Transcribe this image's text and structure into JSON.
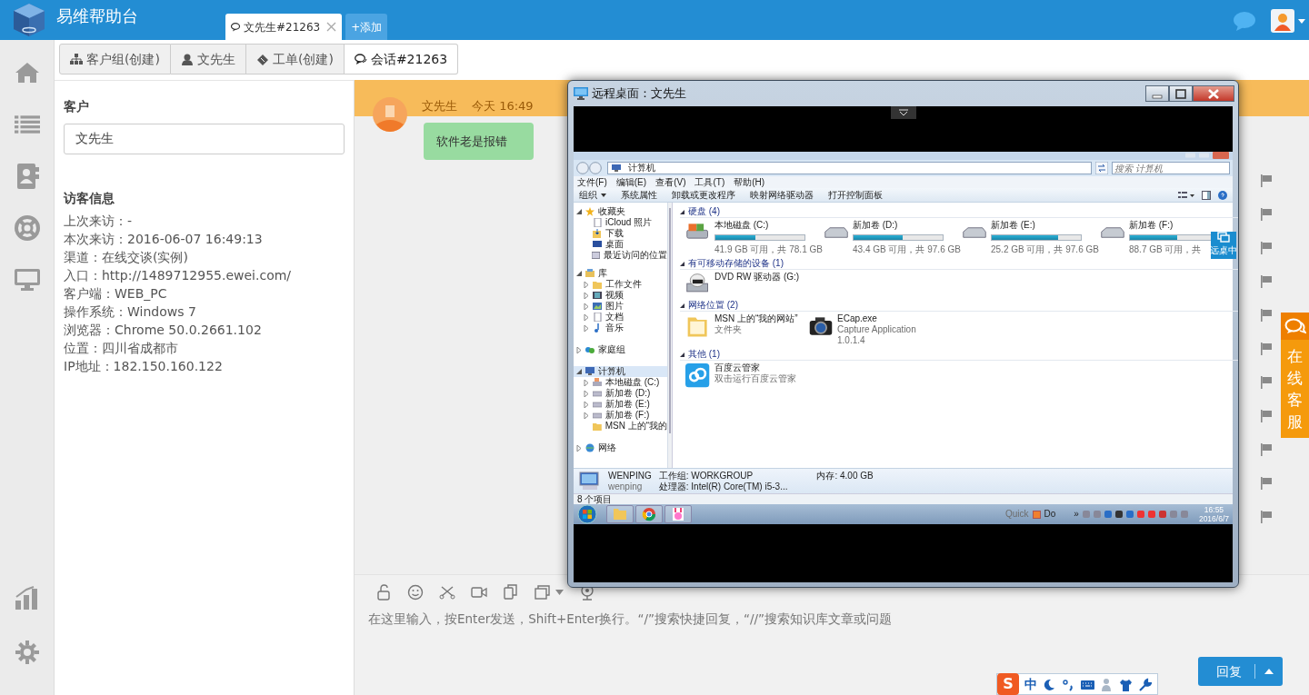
{
  "app": {
    "title": "易维帮助台"
  },
  "top_tabs": [
    {
      "label": "文先生#21263",
      "selected": true,
      "closable": true
    },
    {
      "label": "+添加",
      "selected": false,
      "closable": false
    }
  ],
  "breadcrumb": [
    {
      "kind": "group",
      "label": "客户组(创建)",
      "selected": false
    },
    {
      "kind": "person",
      "label": "文先生",
      "selected": false
    },
    {
      "kind": "ticket",
      "label": "工单(创建)",
      "selected": false
    },
    {
      "kind": "chat",
      "label": "会话#21263",
      "selected": true
    }
  ],
  "customer": {
    "label": "客户",
    "value": "文先生"
  },
  "visitor_info": {
    "title": "访客信息",
    "lines": [
      "上次来访：-",
      "本次来访：2016-06-07 16:49:13",
      "渠道：在线交谈(实例)",
      "入口：http://1489712955.ewei.com/",
      "客户端：WEB_PC",
      "操作系统：Windows 7",
      "浏览器：Chrome 50.0.2661.102",
      "位置：四川省成都市",
      "IP地址：182.150.160.122"
    ]
  },
  "chat": {
    "messages": [
      {
        "sender": "文先生",
        "time": "今天 16:49",
        "text": "软件老是报错"
      }
    ],
    "placeholder": "在这里输入，按Enter发送，Shift+Enter换行。“/”搜索快捷回复，“//”搜索知识库文章或问题",
    "send_label": "回复"
  },
  "side_widget": {
    "label": "在线客服"
  },
  "ime": {
    "logo": "S",
    "mode": "中"
  },
  "remote": {
    "title": "远程桌面：文先生",
    "explorer": {
      "address": "计算机",
      "search_placeholder": "搜索 计算机",
      "menu": [
        "文件(F)",
        "编辑(E)",
        "查看(V)",
        "工具(T)",
        "帮助(H)"
      ],
      "commands": [
        "组织",
        "系统属性",
        "卸载或更改程序",
        "映射网络驱动器",
        "打开控制面板"
      ],
      "tree": [
        {
          "label": "收藏夹",
          "kind": "star",
          "expanded": true,
          "selected": false,
          "children": [
            {
              "label": "iCloud 照片",
              "kind": "page",
              "selected": false
            },
            {
              "label": "下载",
              "kind": "download",
              "selected": false
            },
            {
              "label": "桌面",
              "kind": "desktop",
              "selected": false
            },
            {
              "label": "最近访问的位置",
              "kind": "recent",
              "selected": false
            }
          ]
        },
        {
          "label": "库",
          "kind": "library",
          "expanded": true,
          "selected": false,
          "children": [
            {
              "label": "工作文件",
              "kind": "folder",
              "expanded": false,
              "selected": false
            },
            {
              "label": "视频",
              "kind": "video",
              "expanded": false,
              "selected": false
            },
            {
              "label": "图片",
              "kind": "image",
              "expanded": false,
              "selected": false
            },
            {
              "label": "文档",
              "kind": "page",
              "expanded": false,
              "selected": false
            },
            {
              "label": "音乐",
              "kind": "music",
              "expanded": false,
              "selected": false
            }
          ]
        },
        {
          "label": "家庭组",
          "kind": "homegroup",
          "expanded": false,
          "selected": false
        },
        {
          "label": "计算机",
          "kind": "computer",
          "expanded": true,
          "selected": true,
          "children": [
            {
              "label": "本地磁盘 (C:)",
              "kind": "system_drive",
              "expanded": false,
              "selected": false
            },
            {
              "label": "新加卷 (D:)",
              "kind": "drive",
              "expanded": false,
              "selected": false
            },
            {
              "label": "新加卷 (E:)",
              "kind": "drive",
              "expanded": false,
              "selected": false
            },
            {
              "label": "新加卷 (F:)",
              "kind": "drive",
              "expanded": false,
              "selected": false
            },
            {
              "label": "MSN 上的“我的",
              "kind": "folder",
              "selected": false
            }
          ]
        },
        {
          "label": "网络",
          "kind": "network",
          "expanded": false,
          "selected": false
        }
      ],
      "groups": [
        {
          "title": "硬盘 (4)",
          "kind": "drives",
          "items": [
            {
              "kind": "system_drive",
              "name": "本地磁盘 (C:)",
              "level": 0.45,
              "detail": "41.9 GB 可用，共 78.1 GB"
            },
            {
              "kind": "drive",
              "name": "新加卷 (D:)",
              "level": 0.55,
              "detail": "43.4 GB 可用，共 97.6 GB"
            },
            {
              "kind": "drive",
              "name": "新加卷 (E:)",
              "level": 0.74,
              "detail": "25.2 GB 可用，共 97.6 GB"
            },
            {
              "kind": "drive",
              "name": "新加卷 (F:)",
              "level": 0.53,
              "detail": "88.7 GB 可用，共"
            }
          ]
        },
        {
          "title": "有可移动存储的设备 (1)",
          "kind": "tiles",
          "items": [
            {
              "kind": "dvd",
              "name": "DVD RW 驱动器 (G:)"
            }
          ]
        },
        {
          "title": "网络位置 (2)",
          "kind": "tiles",
          "items": [
            {
              "kind": "folder",
              "name": "MSN 上的“我的网站”",
              "lines": [
                "文件夹"
              ]
            },
            {
              "kind": "camera",
              "name": "ECap.exe",
              "lines": [
                "Capture Application",
                "1.0.1.4"
              ]
            }
          ]
        },
        {
          "title": "其他 (1)",
          "kind": "tiles",
          "items": [
            {
              "kind": "cloud",
              "name": "百度云管家",
              "lines": [
                "双击运行百度云管家"
              ]
            }
          ]
        }
      ],
      "overlay_badge": "远桌中",
      "details": {
        "name": "WENPING",
        "user": "wenping",
        "workgroup": "工作组: WORKGROUP",
        "memory": "内存: 4.00 GB",
        "cpu": "处理器: Intel(R) Core(TM) i5-3..."
      },
      "status": "8 个项目",
      "taskbar": {
        "quick": "Quick",
        "do": "Do",
        "do_checked": true,
        "chevron": "»",
        "time": "16:55",
        "date": "2016/6/7"
      }
    }
  }
}
